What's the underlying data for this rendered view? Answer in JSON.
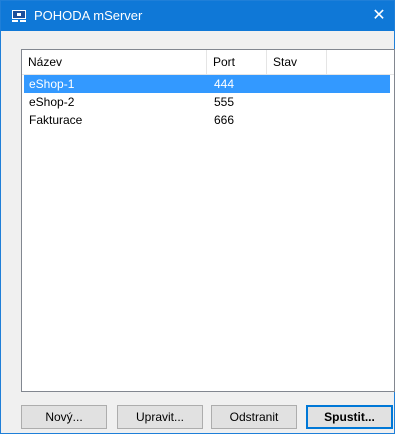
{
  "window": {
    "title": "POHODA mServer",
    "close_glyph": "✕"
  },
  "list": {
    "columns": [
      "Název",
      "Port",
      "Stav"
    ],
    "rows": [
      {
        "name": "eShop-1",
        "port": "444",
        "status": "",
        "selected": true
      },
      {
        "name": "eShop-2",
        "port": "555",
        "status": "",
        "selected": false
      },
      {
        "name": "Fakturace",
        "port": "666",
        "status": "",
        "selected": false
      }
    ]
  },
  "buttons": {
    "new": "Nový...",
    "edit": "Upravit...",
    "remove": "Odstranit",
    "start": "Spustit..."
  },
  "colors": {
    "titlebar": "#0f78d7",
    "selection": "#3399ff"
  },
  "icons": {
    "app": "pohoda-app-icon",
    "close": "close-icon"
  }
}
